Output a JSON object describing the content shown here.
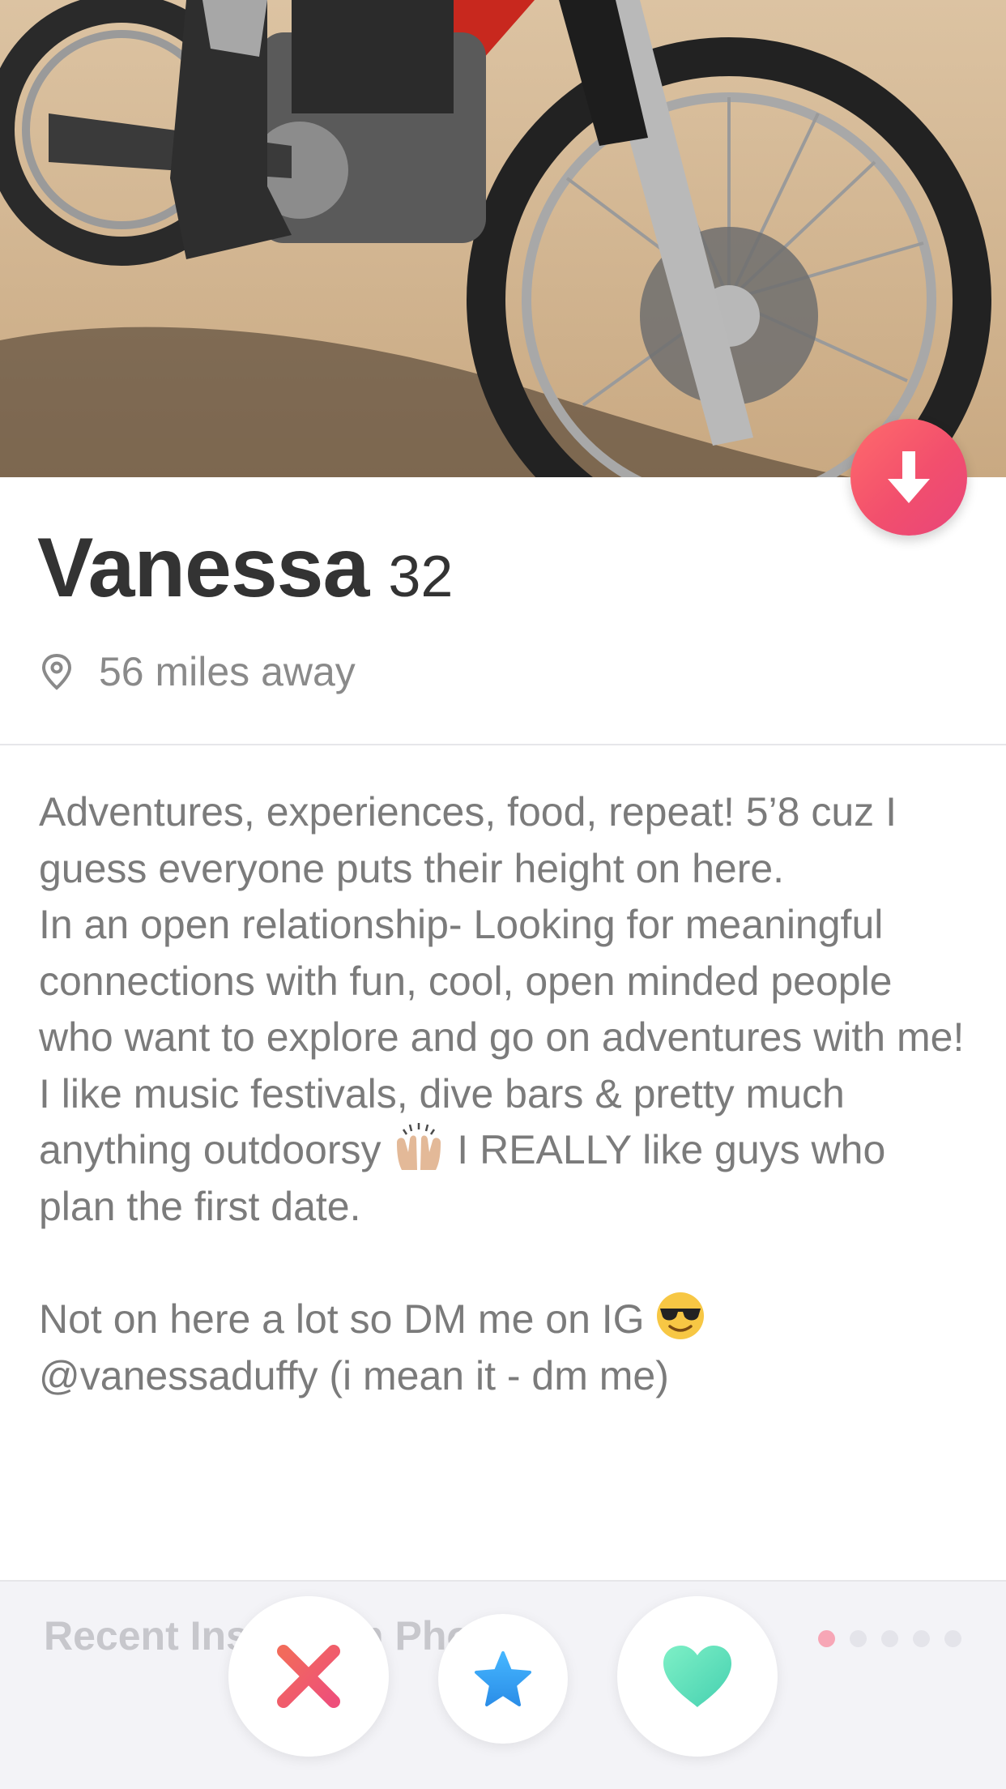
{
  "profile": {
    "name": "Vanessa",
    "age": "32",
    "distance": "56 miles away"
  },
  "bio": {
    "line1": "Adventures, experiences, food, repeat! 5’8 cuz I guess everyone puts their height on here.",
    "line2": "In an open relationship- Looking for meaningful connections with fun, cool, open minded people who want to explore and go on adventures with me!",
    "line3_before_emoji": "I like music festivals, dive bars & pretty much anything outdoorsy ",
    "line3_after_emoji": " I REALLY like guys who plan the first date.",
    "line4_before_emoji": "Not on here a lot so DM me on IG ",
    "line4_after_emoji": "@vanessaduffy (i mean it - dm me)"
  },
  "instagram": {
    "section_label": "Recent Instagram Photos",
    "page_dots_total": 5,
    "page_dot_active": 1
  },
  "actions": {
    "nope_icon": "x-icon",
    "super_like_icon": "star-icon",
    "like_icon": "heart-icon",
    "collapse_icon": "arrow-down-icon"
  },
  "colors": {
    "nope": "#f0506e",
    "super_like": "#3ca4ff",
    "like": "#5fe0b8",
    "collapse_button": "#f24f6d",
    "active_dot": "#f7a6b6"
  }
}
